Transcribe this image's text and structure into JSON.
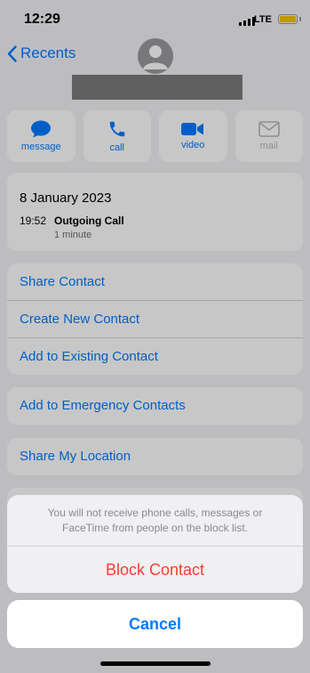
{
  "status": {
    "time": "12:29",
    "network": "LTE",
    "battery_color": "#f5c400"
  },
  "nav": {
    "back_label": "Recents"
  },
  "actions": [
    {
      "label": "message",
      "icon": "message-icon"
    },
    {
      "label": "call",
      "icon": "phone-icon"
    },
    {
      "label": "video",
      "icon": "video-icon"
    },
    {
      "label": "mail",
      "icon": "mail-icon",
      "disabled": true
    }
  ],
  "call_history": {
    "date": "8 January 2023",
    "time": "19:52",
    "type": "Outgoing Call",
    "duration": "1 minute"
  },
  "contact_options": [
    "Share Contact",
    "Create New Contact",
    "Add to Existing Contact"
  ],
  "emergency": "Add to Emergency Contacts",
  "location": "Share My Location",
  "sheet": {
    "message": "You will not receive phone calls, messages or FaceTime from people on the block list.",
    "block_label": "Block Contact",
    "cancel_label": "Cancel"
  },
  "colors": {
    "accent": "#007aff",
    "destructive": "#ff3b30"
  }
}
